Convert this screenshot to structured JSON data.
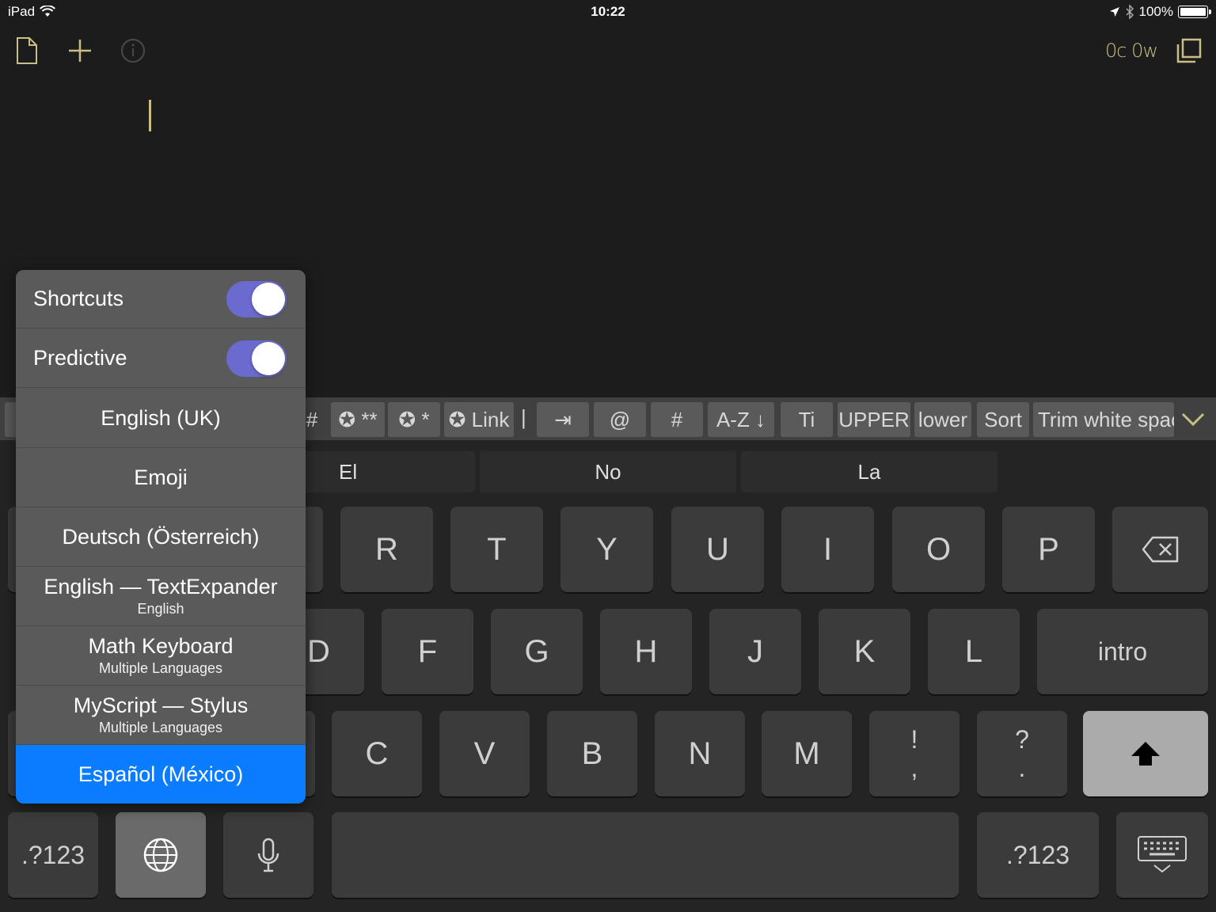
{
  "status_bar": {
    "device": "iPad",
    "time": "10:22",
    "battery": "100%",
    "battery_level": 1.0
  },
  "toolbar": {
    "new_doc_icon": "document-icon",
    "add_icon": "plus-icon",
    "info_icon": "info-icon",
    "word_count": "0c 0w",
    "fullscreen_icon": "expand-icon"
  },
  "extra_keys": {
    "items": [
      {
        "label": "#"
      },
      {
        "label": "✪ **"
      },
      {
        "label": "✪ *"
      },
      {
        "label": "✪ Link"
      },
      {
        "label": "⇥"
      },
      {
        "label": "@"
      },
      {
        "label": "#"
      },
      {
        "label": "A-Z ↓"
      },
      {
        "label": "Ti"
      },
      {
        "label": "UPPER"
      },
      {
        "label": "lower"
      },
      {
        "label": "Sort"
      },
      {
        "label": "Trim white space"
      }
    ],
    "separator": "|"
  },
  "suggestions": [
    "El",
    "No",
    "La"
  ],
  "keyboard": {
    "row1": [
      "R",
      "T",
      "Y",
      "U",
      "I",
      "O",
      "P"
    ],
    "row2": [
      "D",
      "F",
      "G",
      "H",
      "J",
      "K",
      "L"
    ],
    "row2_return": "intro",
    "row3": [
      "C",
      "V",
      "B",
      "N",
      "M"
    ],
    "row3_punct1_top": "!",
    "row3_punct1_bottom": ",",
    "row3_punct2_top": "?",
    "row3_punct2_bottom": ".",
    "numbers_label": ".?123"
  },
  "language_menu": {
    "shortcuts_label": "Shortcuts",
    "shortcuts_on": true,
    "predictive_label": "Predictive",
    "predictive_on": true,
    "languages": [
      {
        "title": "English (UK)",
        "subtitle": ""
      },
      {
        "title": "Emoji",
        "subtitle": ""
      },
      {
        "title": "Deutsch (Österreich)",
        "subtitle": ""
      },
      {
        "title": "English — TextExpander",
        "subtitle": "English"
      },
      {
        "title": "Math Keyboard",
        "subtitle": "Multiple Languages"
      },
      {
        "title": "MyScript — Stylus",
        "subtitle": "Multiple Languages"
      },
      {
        "title": "Español (México)",
        "subtitle": "",
        "selected": true
      }
    ]
  },
  "colors": {
    "accent": "#c9bf86",
    "selected": "#0a7cff",
    "toggle_on": "#6b6bcf"
  }
}
